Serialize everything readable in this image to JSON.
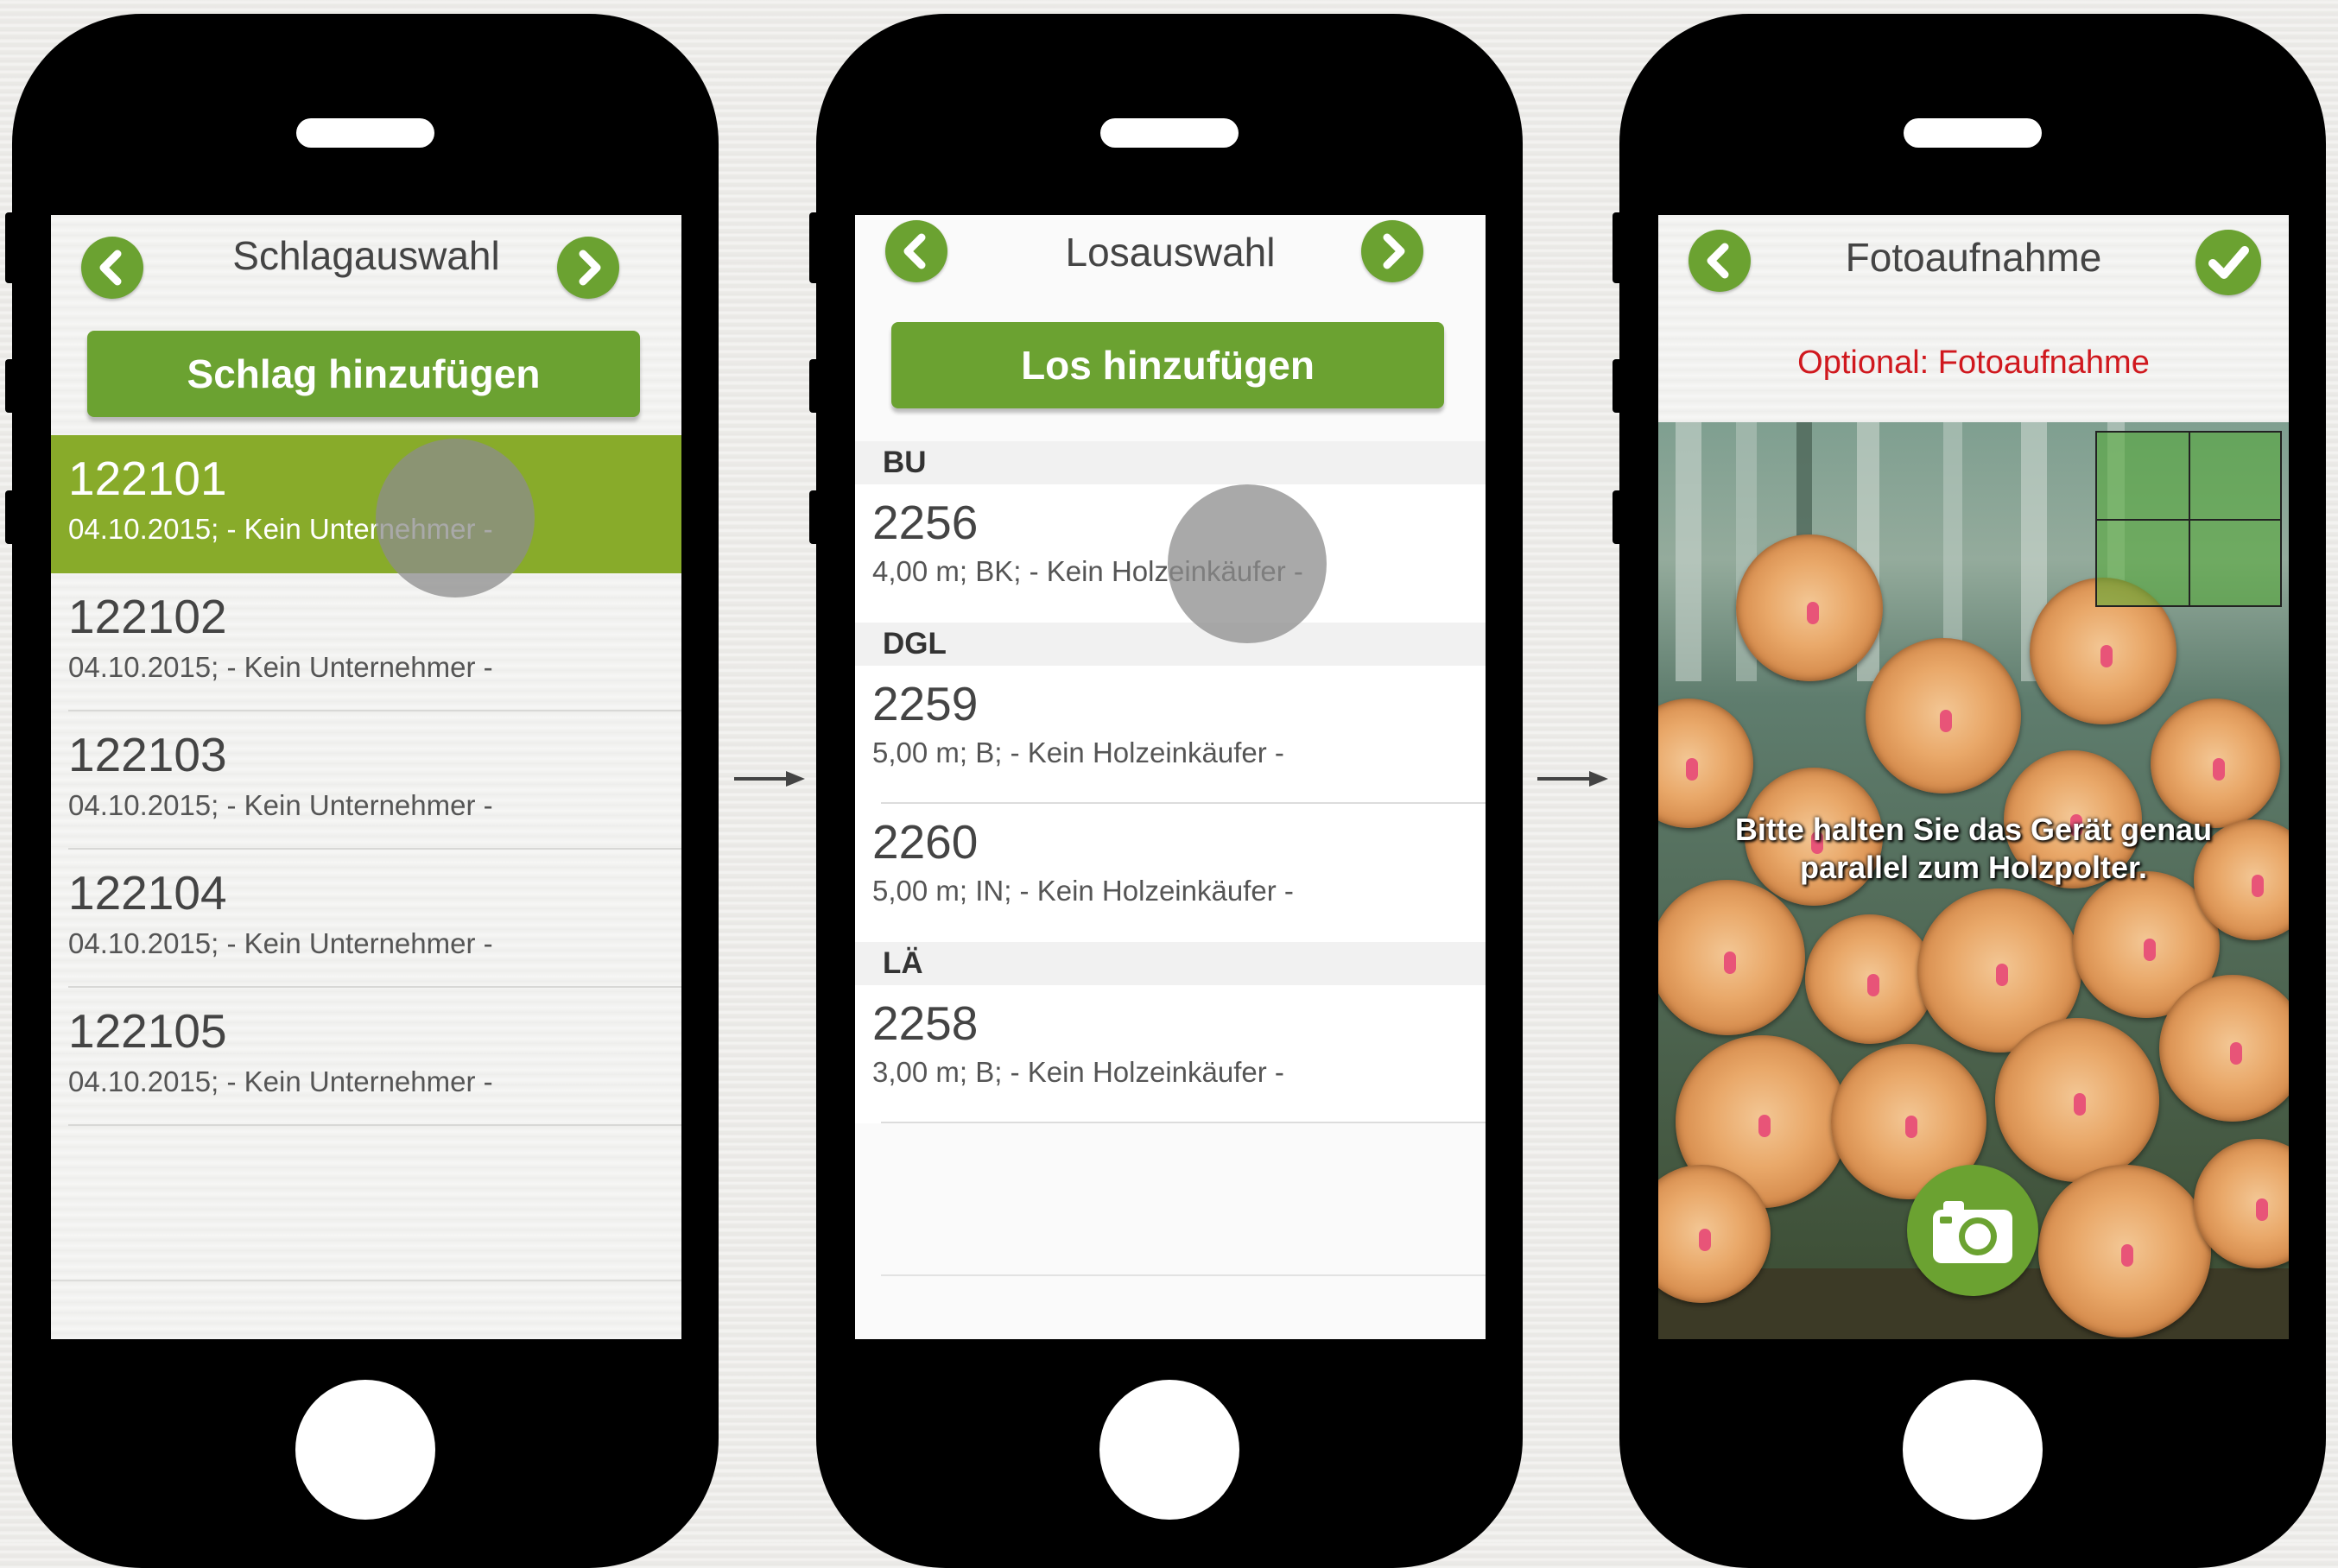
{
  "screens": [
    {
      "title": "Schlagauswahl",
      "add_button": "Schlag hinzufügen",
      "rows": [
        {
          "number": "122101",
          "detail": "04.10.2015; - Kein Unternehmer -",
          "selected": true
        },
        {
          "number": "122102",
          "detail": "04.10.2015; - Kein Unternehmer -",
          "selected": false
        },
        {
          "number": "122103",
          "detail": "04.10.2015; - Kein Unternehmer -",
          "selected": false
        },
        {
          "number": "122104",
          "detail": "04.10.2015; - Kein Unternehmer -",
          "selected": false
        },
        {
          "number": "122105",
          "detail": "04.10.2015; - Kein Unternehmer -",
          "selected": false
        }
      ]
    },
    {
      "title": "Losauswahl",
      "add_button": "Los hinzufügen",
      "sections": [
        {
          "header": "BU",
          "rows": [
            {
              "number": "2256",
              "detail": "4,00 m; BK; - Kein Holzeinkäufer -"
            }
          ]
        },
        {
          "header": "DGL",
          "rows": [
            {
              "number": "2259",
              "detail": "5,00 m; B; - Kein Holzeinkäufer -"
            },
            {
              "number": "2260",
              "detail": "5,00 m; IN; - Kein Holzeinkäufer -"
            }
          ]
        },
        {
          "header": "LÄ",
          "rows": [
            {
              "number": "2258",
              "detail": "3,00 m; B; - Kein Holzeinkäufer -"
            }
          ]
        }
      ]
    },
    {
      "title": "Fotoaufnahme",
      "optional_label": "Optional: Fotoaufnahme",
      "guide_text_line1": "Bitte halten Sie das Gerät genau",
      "guide_text_line2": "parallel zum Holzpolter."
    }
  ],
  "icons": {
    "back": "chevron-left-icon",
    "forward": "chevron-right-icon",
    "confirm": "checkmark-icon",
    "camera": "camera-icon",
    "flow_arrow": "arrow-right-icon"
  },
  "colors": {
    "accent_green": "#6ba231",
    "selected_row": "#88ab2a",
    "optional_red": "#d0181e",
    "phone_body": "#000000"
  }
}
